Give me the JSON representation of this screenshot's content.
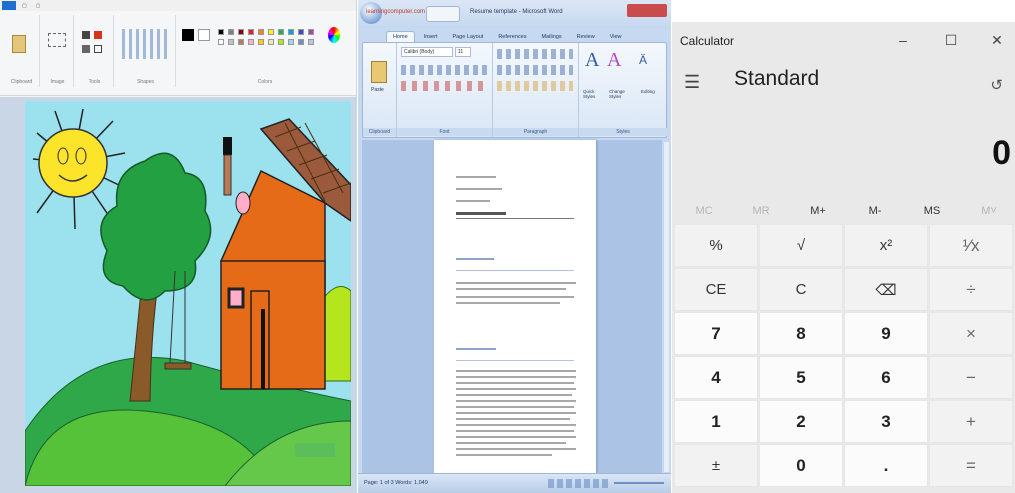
{
  "word": {
    "site_text": "learningcomputer.com",
    "window_title": "Resume template - Microsoft Word",
    "tabs": [
      "Home",
      "Insert",
      "Page Layout",
      "References",
      "Mailings",
      "Review",
      "View"
    ],
    "font_name": "Calibri (Body)",
    "font_size": "11",
    "group_labels": [
      "Clipboard",
      "Font",
      "Paragraph",
      "Styles"
    ],
    "ribbon_buttons": [
      "Paste",
      "Quick Styles",
      "Change Styles",
      "Editing"
    ],
    "status_text": "Page: 1 of 3    Words: 1,049"
  },
  "paint": {
    "group_labels": [
      "Clipboard",
      "Image",
      "Tools",
      "Shapes",
      "Colors"
    ],
    "palette": [
      "#000000",
      "#7f7f7f",
      "#880015",
      "#ed1c24",
      "#ff7f27",
      "#fff200",
      "#22b14c",
      "#00a2e8",
      "#3f48cc",
      "#a349a4",
      "#ffffff",
      "#c3c3c3",
      "#b97a57",
      "#ffaec9",
      "#ffc90e",
      "#efe4b0",
      "#b5e61d",
      "#99d9ea",
      "#7092be",
      "#c8bfe7"
    ]
  },
  "calc": {
    "title": "Calculator",
    "mode": "Standard",
    "display": "0",
    "window_controls": [
      "–",
      "☐",
      "✕"
    ],
    "memory": [
      {
        "label": "MC",
        "enabled": false
      },
      {
        "label": "MR",
        "enabled": false
      },
      {
        "label": "M+",
        "enabled": true
      },
      {
        "label": "M-",
        "enabled": true
      },
      {
        "label": "MS",
        "enabled": true
      },
      {
        "label": "M˅",
        "enabled": false
      }
    ],
    "keys": [
      [
        "%",
        "√",
        "x²",
        "¹⁄x"
      ],
      [
        "CE",
        "C",
        "⌫",
        "÷"
      ],
      [
        "7",
        "8",
        "9",
        "×"
      ],
      [
        "4",
        "5",
        "6",
        "−"
      ],
      [
        "1",
        "2",
        "3",
        "+"
      ],
      [
        "±",
        "0",
        ".",
        "="
      ]
    ],
    "colors": {
      "background": "#e9e9e9",
      "number_key": "#fbfbfb",
      "function_key": "#f2f2f2"
    }
  }
}
